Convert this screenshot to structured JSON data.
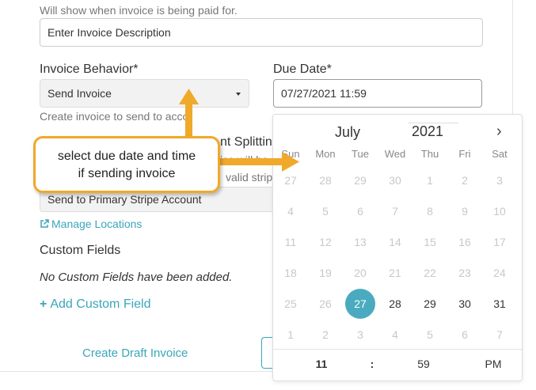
{
  "description_help": "Will show when invoice is being paid for.",
  "description_input": {
    "placeholder": "Enter Invoice Description"
  },
  "invoice_behavior": {
    "label": "Invoice Behavior*",
    "value": "Send Invoice",
    "help": "Create invoice to send to acco"
  },
  "due_date": {
    "label": "Due Date*",
    "value": "07/27/2021 11:59"
  },
  "payment_splitting": {
    "label_partial": "nt Splitting",
    "help_partial": "ice will be",
    "help_partial2": "valid strip",
    "select_value": "Send to Primary Stripe Account"
  },
  "manage_locations": "Manage Locations",
  "custom_fields": {
    "title": "Custom Fields",
    "empty": "No Custom Fields have been added.",
    "add": "Add Custom Field"
  },
  "create_draft": "Create Draft Invoice",
  "callout": {
    "line1": "select due date and time",
    "line2": "if sending invoice"
  },
  "calendar": {
    "month": "July",
    "year": "2021",
    "weekdays": [
      "Sun",
      "Mon",
      "Tue",
      "Wed",
      "Thu",
      "Fri",
      "Sat"
    ],
    "weeks": [
      [
        "27",
        "28",
        "29",
        "30",
        "1",
        "2",
        "3"
      ],
      [
        "4",
        "5",
        "6",
        "7",
        "8",
        "9",
        "10"
      ],
      [
        "11",
        "12",
        "13",
        "14",
        "15",
        "16",
        "17"
      ],
      [
        "18",
        "19",
        "20",
        "21",
        "22",
        "23",
        "24"
      ],
      [
        "25",
        "26",
        "27",
        "28",
        "29",
        "30",
        "31"
      ],
      [
        "1",
        "2",
        "3",
        "4",
        "5",
        "6",
        "7"
      ]
    ],
    "muted": [
      [
        true,
        true,
        true,
        true,
        true,
        true,
        true
      ],
      [
        true,
        true,
        true,
        true,
        true,
        true,
        true
      ],
      [
        true,
        true,
        true,
        true,
        true,
        true,
        true
      ],
      [
        true,
        true,
        true,
        true,
        true,
        true,
        true
      ],
      [
        true,
        true,
        false,
        false,
        false,
        false,
        false
      ],
      [
        true,
        true,
        true,
        true,
        true,
        true,
        true
      ]
    ],
    "selected": "27",
    "hour": "11",
    "separator": ":",
    "minute": "59",
    "meridiem": "PM"
  },
  "colors": {
    "accent": "#3aa6b9",
    "selected": "#4aabc0",
    "callout_border": "#f0a92a"
  }
}
